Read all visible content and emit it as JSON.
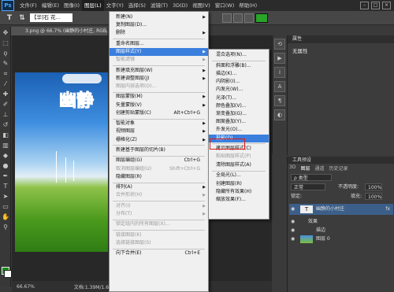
{
  "menubar": {
    "logo": "Ps",
    "items": [
      "文件(F)",
      "编辑(E)",
      "图像(I)",
      "图层(L)",
      "文字(Y)",
      "选择(S)",
      "滤镜(T)",
      "3D(D)",
      "视图(V)",
      "窗口(W)",
      "帮助(H)"
    ],
    "active_index": 3
  },
  "optionsbar": {
    "tool_glyph": "T",
    "orient_glyph": "⇅",
    "font_name": "【华]石 花...",
    "color_hex": "#2aa52a"
  },
  "document": {
    "tab": "3.png @ 66.7% (幽静的小村庄, RGB/8",
    "art_text": "幽静"
  },
  "statusbar": {
    "zoom": "66.67%",
    "doc_info": "文档:1.39M/1.64M"
  },
  "layer_menu": {
    "items": [
      {
        "label": "新建(N)",
        "arrow": true
      },
      {
        "label": "复制图层(D)..."
      },
      {
        "label": "删除",
        "arrow": true
      },
      {
        "sep": true
      },
      {
        "label": "重命名图层..."
      },
      {
        "label": "图层样式(Y)",
        "arrow": true,
        "highlight": true
      },
      {
        "label": "智能滤镜",
        "disabled": true,
        "arrow": true
      },
      {
        "sep": true
      },
      {
        "label": "新建填充图层(W)",
        "arrow": true
      },
      {
        "label": "新建调整图层(J)",
        "arrow": true
      },
      {
        "label": "图层内容选项(O)...",
        "disabled": true
      },
      {
        "sep": true
      },
      {
        "label": "图层蒙版(M)",
        "arrow": true
      },
      {
        "label": "矢量蒙版(V)",
        "arrow": true
      },
      {
        "label": "创建剪贴蒙版(C)",
        "shortcut": "Alt+Ctrl+G"
      },
      {
        "sep": true
      },
      {
        "label": "智能对象",
        "arrow": true
      },
      {
        "label": "视频图层",
        "arrow": true
      },
      {
        "label": "栅格化(Z)",
        "arrow": true
      },
      {
        "sep": true
      },
      {
        "label": "新建基于图层的切片(B)"
      },
      {
        "sep": true
      },
      {
        "label": "图层编组(G)",
        "shortcut": "Ctrl+G"
      },
      {
        "label": "取消图层编组(U)",
        "shortcut": "Shift+Ctrl+G",
        "disabled": true
      },
      {
        "label": "隐藏图层(R)"
      },
      {
        "sep": true
      },
      {
        "label": "排列(A)",
        "arrow": true
      },
      {
        "label": "合并形状(H)",
        "arrow": true,
        "disabled": true
      },
      {
        "sep": true
      },
      {
        "label": "对齐(I)",
        "arrow": true,
        "disabled": true
      },
      {
        "label": "分布(T)",
        "arrow": true,
        "disabled": true
      },
      {
        "sep": true
      },
      {
        "label": "锁定组内的所有图层(X)...",
        "disabled": true
      },
      {
        "sep": true
      },
      {
        "label": "链接图层(K)",
        "disabled": true
      },
      {
        "label": "选择链接图层(S)",
        "disabled": true
      },
      {
        "sep": true
      },
      {
        "label": "向下合并(E)",
        "shortcut": "Ctrl+E"
      }
    ]
  },
  "layer_style_submenu": {
    "items": [
      {
        "label": "混合选项(N)..."
      },
      {
        "sep": true
      },
      {
        "label": "斜面和浮雕(B)..."
      },
      {
        "label": "描边(K)..."
      },
      {
        "label": "内阴影(I)..."
      },
      {
        "label": "内发光(W)..."
      },
      {
        "label": "光泽(T)..."
      },
      {
        "label": "颜色叠加(V)..."
      },
      {
        "label": "渐变叠加(G)..."
      },
      {
        "label": "图案叠加(Y)..."
      },
      {
        "label": "外发光(O)..."
      },
      {
        "label": "投影(D)...",
        "highlight": true
      },
      {
        "sep": true
      },
      {
        "label": "拷贝图层样式(C)"
      },
      {
        "label": "粘贴图层样式(P)",
        "disabled": true
      },
      {
        "label": "清除图层样式(A)"
      },
      {
        "sep": true
      },
      {
        "label": "全局光(L)..."
      },
      {
        "label": "创建图层(R)"
      },
      {
        "label": "隐藏所有效果(H)"
      },
      {
        "label": "缩放效果(F)..."
      }
    ]
  },
  "properties_panel": {
    "title": "属性",
    "body": "无属性"
  },
  "layers_panel": {
    "title": "工具预设",
    "tabs": [
      "3D",
      "图层",
      "通道",
      "历史记录"
    ],
    "active_tab": 1,
    "filter": "ρ 类型",
    "blend_mode": "正常",
    "opacity_label": "不透明度:",
    "opacity": "100%",
    "lock_label": "锁定:",
    "fill_label": "填充:",
    "fill": "100%",
    "layers": [
      {
        "name": "幽静的小村庄",
        "thumb": "T",
        "fx": "fx",
        "selected": true
      },
      {
        "name": "效果",
        "indent": 1
      },
      {
        "name": "描边",
        "indent": 2
      },
      {
        "name": "图层 0",
        "image": true
      }
    ]
  }
}
